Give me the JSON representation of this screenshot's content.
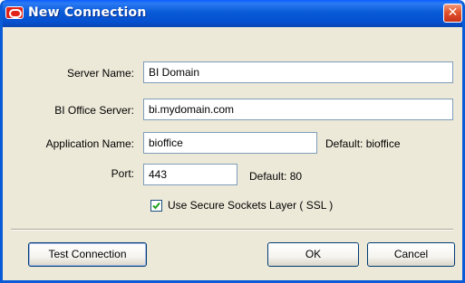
{
  "window": {
    "title": "New Connection",
    "close_glyph": "✕"
  },
  "form": {
    "server_name": {
      "label": "Server Name:",
      "value": "BI Domain"
    },
    "bi_office_server": {
      "label": "BI Office Server:",
      "value": "bi.mydomain.com"
    },
    "application_name": {
      "label": "Application Name:",
      "value": "bioffice",
      "default_hint": "Default: bioffice"
    },
    "port": {
      "label": "Port:",
      "value": "443",
      "default_hint": "Default: 80"
    },
    "ssl": {
      "label": "Use Secure Sockets Layer ( SSL )",
      "checked": true
    }
  },
  "buttons": {
    "test_connection": "Test Connection",
    "ok": "OK",
    "cancel": "Cancel"
  },
  "icons": {
    "app": "oracle-icon",
    "close": "close-icon",
    "check": "checkmark-icon"
  },
  "colors": {
    "titlebar": "#0a5bd7",
    "close_button": "#e2532c",
    "dialog_background": "#ece9d8",
    "check_mark": "#21a121"
  }
}
